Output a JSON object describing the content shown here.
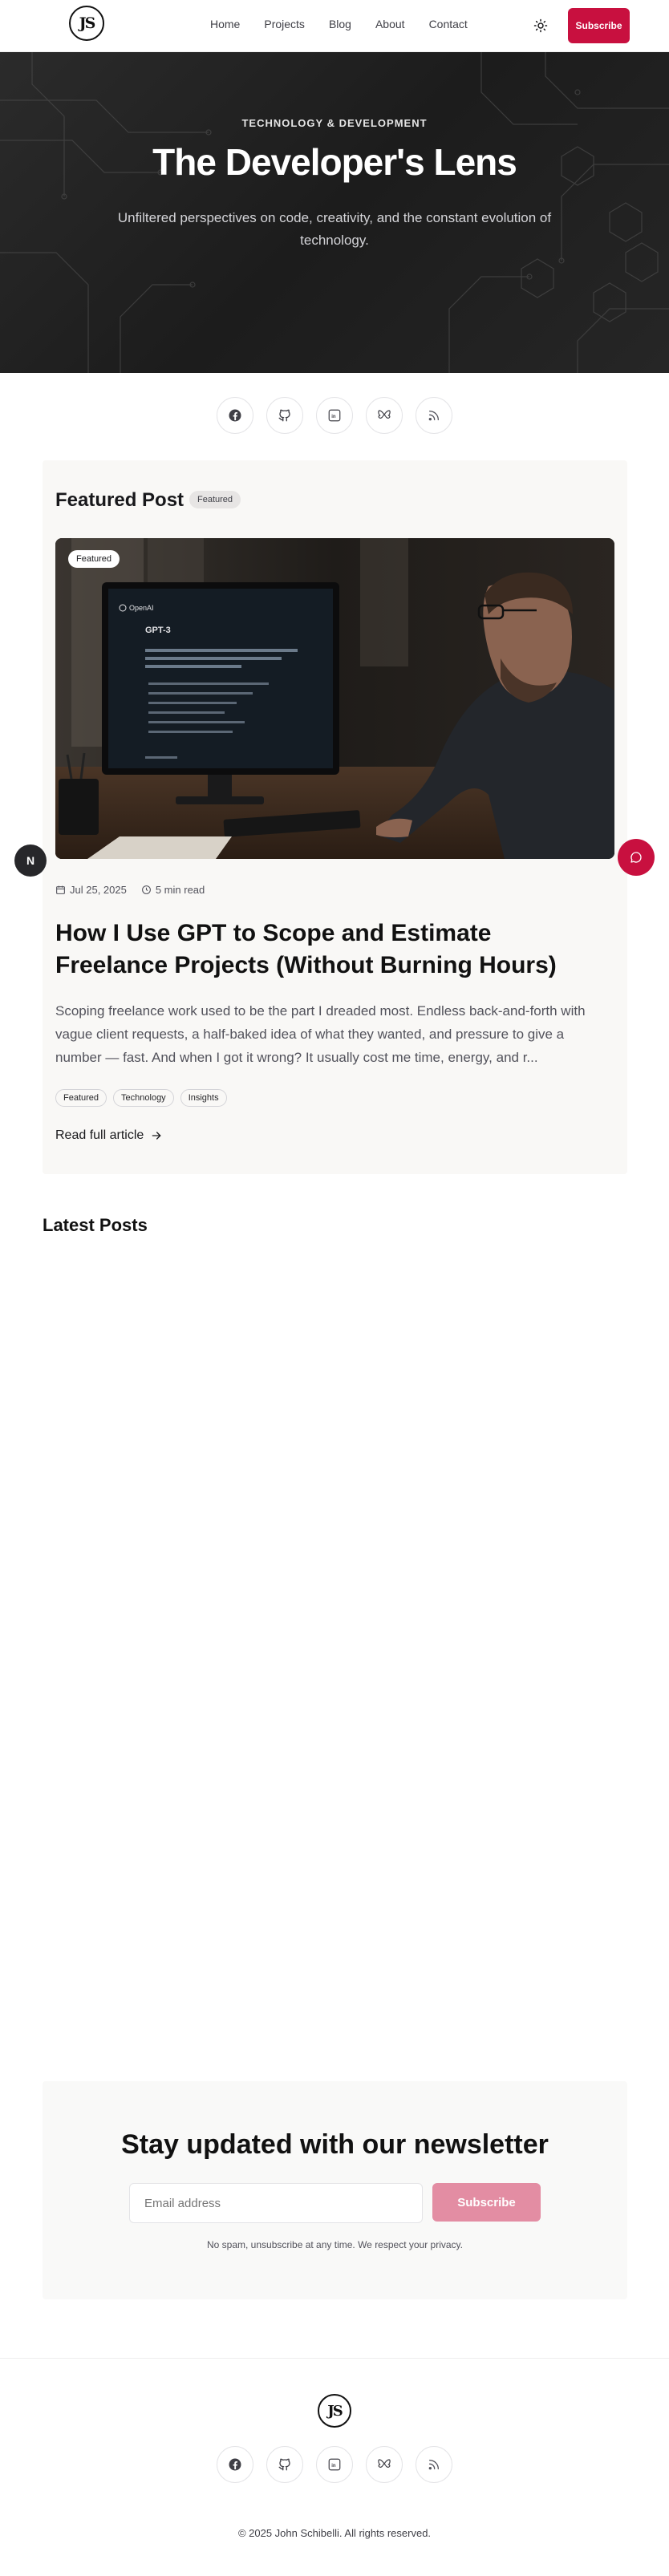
{
  "header": {
    "logo_text": "JS",
    "nav": [
      "Home",
      "Projects",
      "Blog",
      "About",
      "Contact"
    ],
    "theme_icon": "sun-icon",
    "subscribe_label": "Subscribe"
  },
  "hero": {
    "kicker": "TECHNOLOGY & DEVELOPMENT",
    "title": "The Developer's Lens",
    "subtitle": "Unfiltered perspectives on code, creativity, and the constant evolution of technology."
  },
  "social_icons": [
    "facebook-icon",
    "github-icon",
    "linkedin-icon",
    "bluesky-icon",
    "rss-icon"
  ],
  "featured": {
    "heading": "Featured Post",
    "pill": "Featured",
    "image_badge": "Featured",
    "date": "Jul 25, 2025",
    "read_time": "5 min read",
    "title": "How I Use GPT to Scope and Estimate Freelance Projects (Without Burning Hours)",
    "excerpt": "Scoping freelance work used to be the part I dreaded most. Endless back-and-forth with vague client requests, a half-baked idea of what they wanted, and pressure to give a number — fast. And when I got it wrong? It usually cost me time, energy, and r...",
    "tags": [
      "Featured",
      "Technology",
      "Insights"
    ],
    "read_more": "Read full article",
    "screen_brand": "OpenAI",
    "screen_title": "GPT-3"
  },
  "floating": {
    "left_label": "N",
    "right_icon": "chat-icon"
  },
  "latest": {
    "heading": "Latest Posts"
  },
  "newsletter": {
    "title": "Stay updated with our newsletter",
    "placeholder": "Email address",
    "button": "Subscribe",
    "note": "No spam, unsubscribe at any time. We respect your privacy."
  },
  "footer": {
    "logo_text": "JS",
    "copyright": "© 2025 John Schibelli. All rights reserved."
  },
  "colors": {
    "accent": "#c8103f",
    "accent_disabled": "#e38da3",
    "hero_bg": "#222222"
  }
}
